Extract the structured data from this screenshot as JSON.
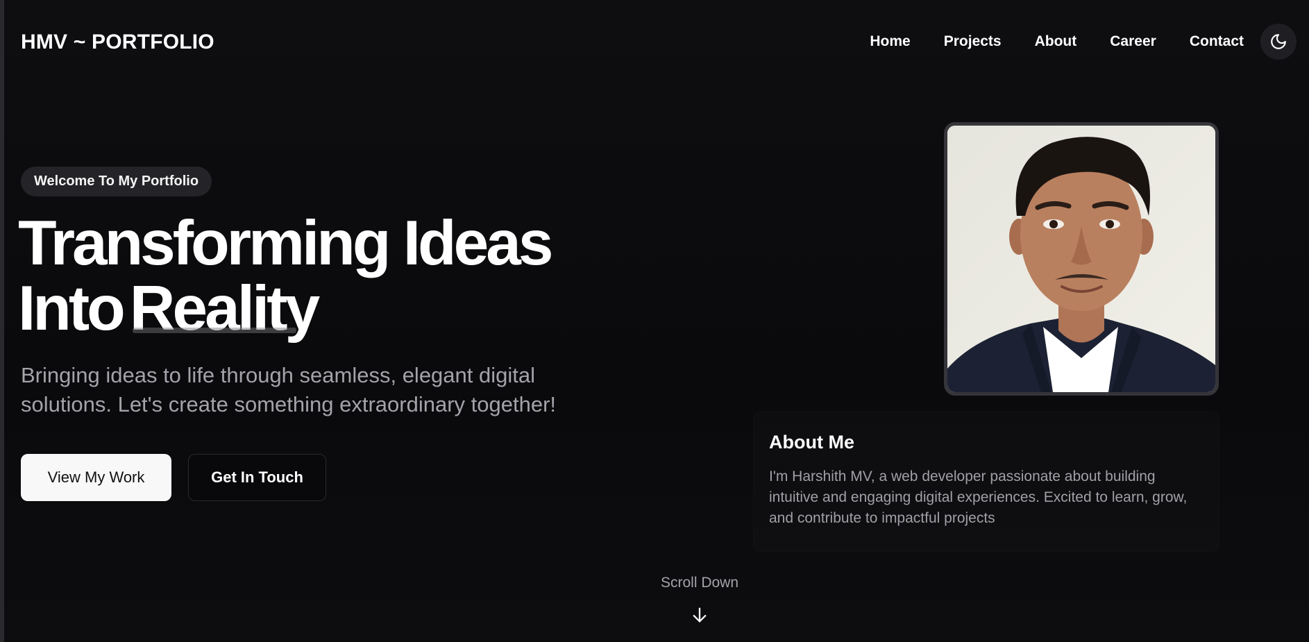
{
  "header": {
    "logo": "HMV ~ PORTFOLIO",
    "nav": [
      "Home",
      "Projects",
      "About",
      "Career",
      "Contact"
    ],
    "theme_toggle_icon": "moon-icon"
  },
  "hero": {
    "badge": "Welcome To My Portfolio",
    "headline_line1": "Transforming Ideas",
    "headline_line2_start": "Into",
    "headline_line2_accent": "Reality",
    "subtitle": "Bringing ideas to life through seamless, elegant digital solutions. Let's create something extraordinary together!",
    "primary_button": "View My Work",
    "secondary_button": "Get In Touch"
  },
  "about": {
    "title": "About Me",
    "text": "I'm Harshith MV, a web developer passionate about building intuitive and engaging digital experiences. Excited to learn, grow, and contribute to impactful projects"
  },
  "scroll": {
    "label": "Scroll Down",
    "icon": "arrow-down-icon"
  },
  "colors": {
    "background": "#0b0b0d",
    "text": "#ffffff",
    "muted": "#a3a3aa",
    "badge_bg": "#242428",
    "primary_button_bg": "#f8f8f8"
  }
}
